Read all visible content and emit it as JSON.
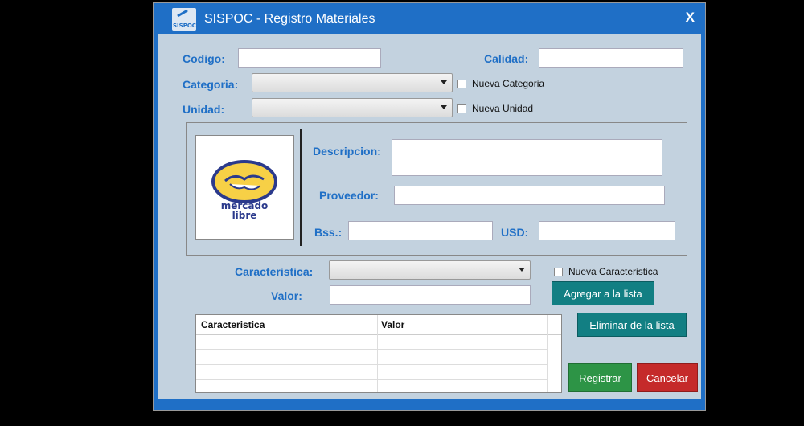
{
  "window": {
    "title": "SISPOC - Registro Materiales",
    "close_label": "X",
    "icon_text": "SISPOC"
  },
  "form": {
    "codigo_label": "Codigo:",
    "codigo_value": "",
    "calidad_label": "Calidad:",
    "calidad_value": "",
    "categoria_label": "Categoria:",
    "categoria_value": "",
    "nueva_categoria_label": "Nueva Categoria",
    "unidad_label": "Unidad:",
    "unidad_value": "",
    "nueva_unidad_label": "Nueva Unidad",
    "descripcion_label": "Descripcion:",
    "descripcion_value": "",
    "proveedor_label": "Proveedor:",
    "proveedor_value": "",
    "bss_label": "Bss.:",
    "bss_value": "",
    "usd_label": "USD:",
    "usd_value": "",
    "caracteristica_label": "Caracteristica:",
    "caracteristica_value": "",
    "nueva_caracteristica_label": "Nueva Caracteristica",
    "valor_label": "Valor:",
    "valor_value": ""
  },
  "logo": {
    "line1": "mercado",
    "line2": "libre"
  },
  "buttons": {
    "agregar": "Agregar a la lista",
    "eliminar": "Eliminar de la lista",
    "registrar": "Registrar",
    "cancelar": "Cancelar"
  },
  "table": {
    "columns": [
      "Caracteristica",
      "Valor"
    ]
  },
  "colors": {
    "accent": "#1f6fc6",
    "teal": "#127f83",
    "green": "#2d9446",
    "red": "#c52a2a"
  }
}
